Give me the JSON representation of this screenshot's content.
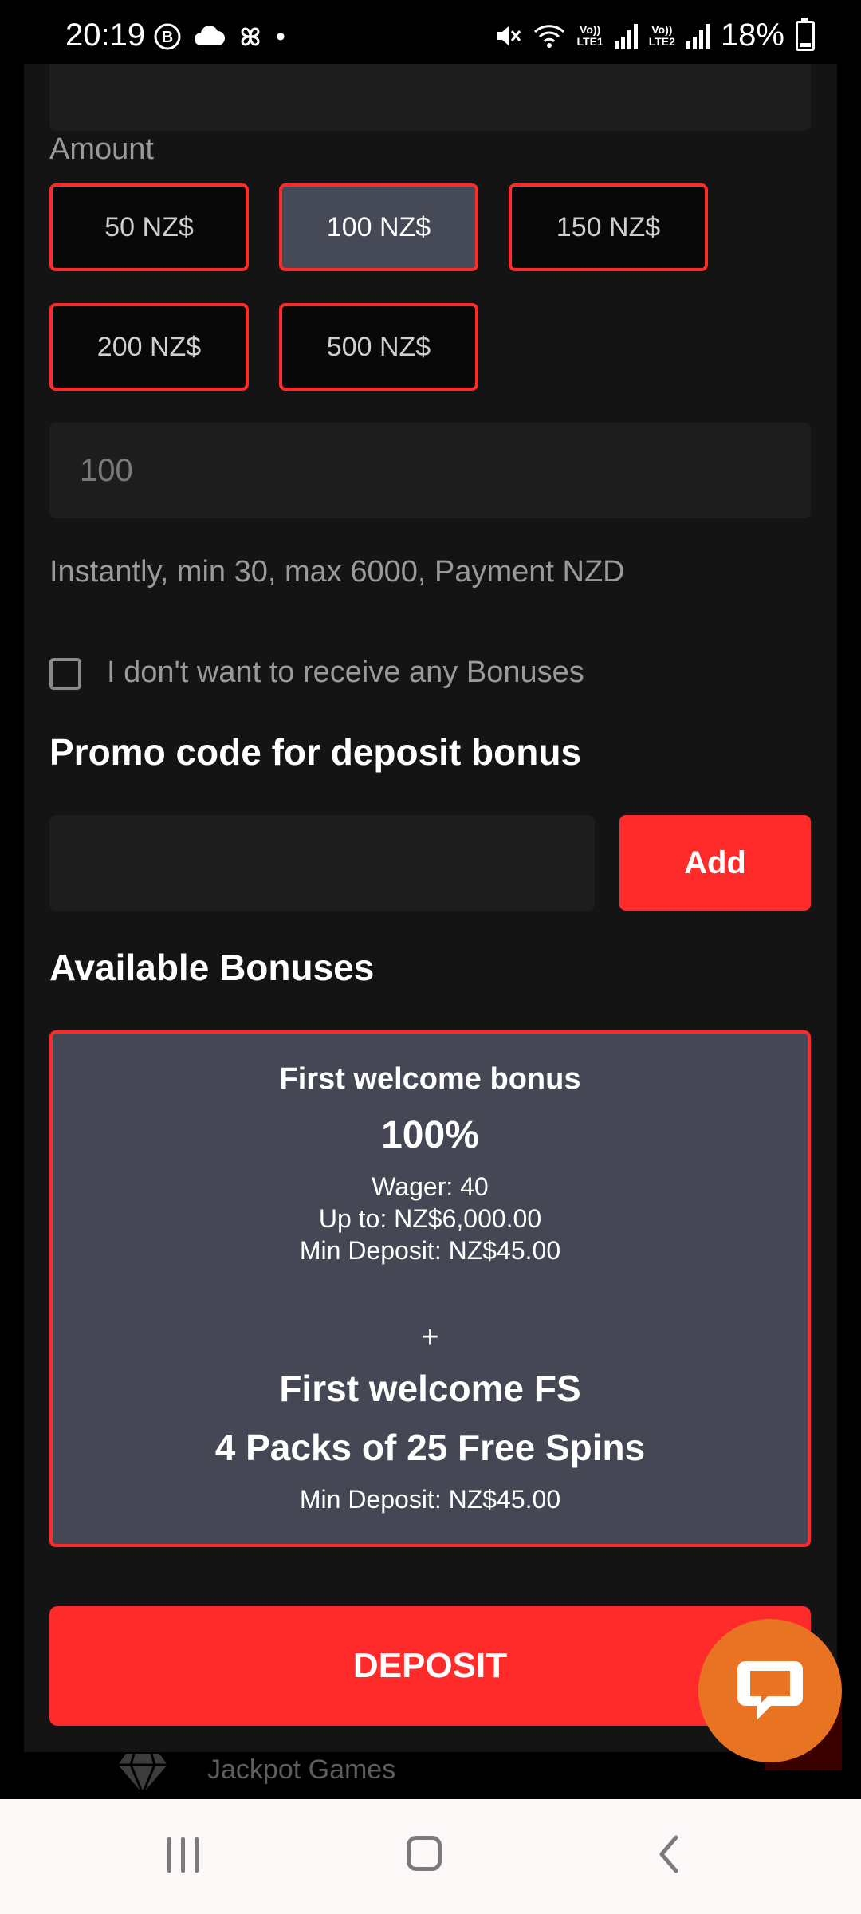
{
  "status_bar": {
    "time": "20:19",
    "left_icons": [
      "b-circle-icon",
      "cloud-icon",
      "pinwheel-icon",
      "dot-icon"
    ],
    "lte1": "LTE1",
    "lte2": "LTE2",
    "vo1": "Vo))",
    "vo2": "Vo))",
    "battery": "18%"
  },
  "deposit_form": {
    "amount_label": "Amount",
    "amount_options": [
      "50 NZ$",
      "100 NZ$",
      "150 NZ$",
      "200 NZ$",
      "500 NZ$"
    ],
    "selected_amount": "100 NZ$",
    "amount_value": "100",
    "limits_hint": "Instantly, min 30, max 6000, Payment NZD",
    "no_bonus_checkbox_label": "I don't want to receive any Bonuses",
    "no_bonus_checked": false,
    "promo_heading": "Promo code for deposit bonus",
    "promo_value": "",
    "add_button": "Add",
    "bonuses_heading": "Available Bonuses",
    "bonus": {
      "title": "First welcome bonus",
      "percent": "100%",
      "wager": "Wager: 40",
      "up_to": "Up to: NZ$6,000.00",
      "min_deposit": "Min Deposit: NZ$45.00",
      "plus": "+",
      "fs_title": "First welcome FS",
      "fs_detail": "4 Packs of 25 Free Spins",
      "fs_min_deposit": "Min Deposit: NZ$45.00"
    },
    "deposit_button": "DEPOSIT"
  },
  "background_menu": {
    "jackpot_label": "Jackpot Games"
  },
  "colors": {
    "accent": "#ff2a2a",
    "panel": "#141414",
    "selected_chip": "#464a57",
    "chat": "#e87322"
  }
}
